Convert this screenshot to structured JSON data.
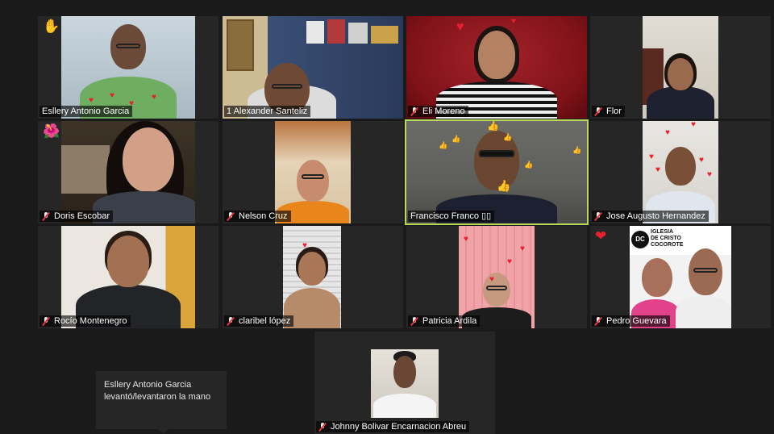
{
  "participants": [
    {
      "name": "Esllery Antonio Garcia",
      "muted": false,
      "reaction": "✋"
    },
    {
      "name": "1 Alexander Santeliz",
      "muted": false
    },
    {
      "name": "Eli Moreno",
      "muted": true
    },
    {
      "name": "Flor",
      "muted": true
    },
    {
      "name": "Doris Escobar",
      "muted": true,
      "reaction": "🌺"
    },
    {
      "name": "Nelson   Cruz",
      "muted": true
    },
    {
      "name": "Francisco Franco ▯▯",
      "muted": false,
      "active_speaker": true
    },
    {
      "name": "Jose Augusto Hernandez",
      "muted": true
    },
    {
      "name": "Rocío Montenegro",
      "muted": true
    },
    {
      "name": "claribel lópez",
      "muted": true
    },
    {
      "name": "Patricia Ardila",
      "muted": true
    },
    {
      "name": "Pedro Guevara",
      "muted": true,
      "reaction": "❤"
    },
    {
      "name": "Johnny Bolivar Encarnacion Abreu",
      "muted": true
    }
  ],
  "church_sign": {
    "logo": "DC",
    "line1": "IGLESIA",
    "line2": "DE CRISTO",
    "line3": "COCOROTE"
  },
  "tooltip": {
    "text": "Esllery Antonio Garcia levantó/levantaron la mano"
  },
  "colors": {
    "background": "#1a1a1a",
    "tile": "#262626",
    "active_border": "#b8d85a",
    "mute_red": "#e0383e"
  }
}
